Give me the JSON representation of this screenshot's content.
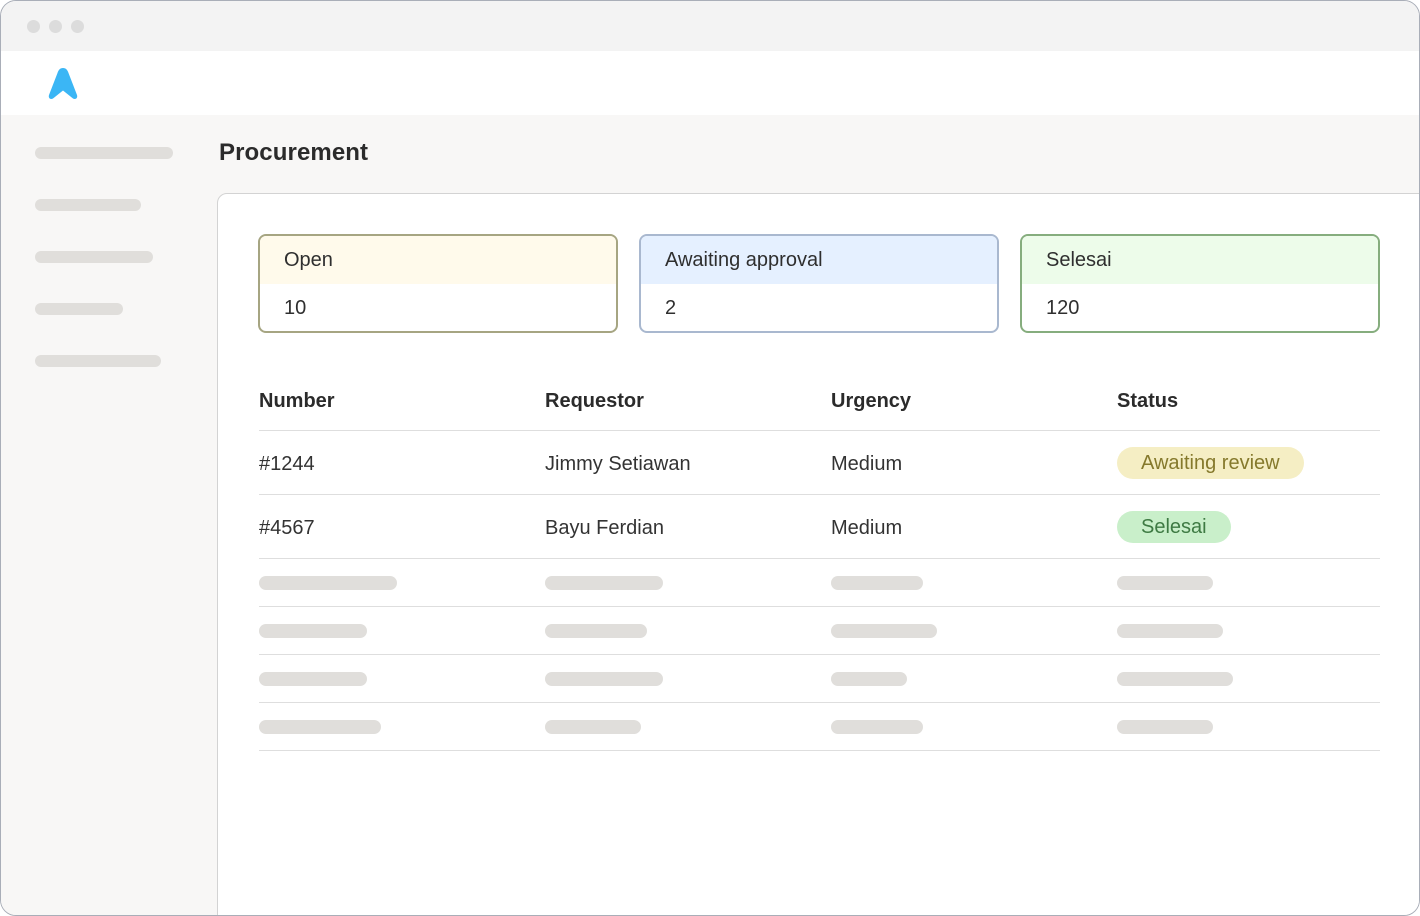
{
  "page": {
    "title": "Procurement"
  },
  "colors": {
    "accent": "#3bb6f5"
  },
  "summary": [
    {
      "label": "Open",
      "value": "10",
      "border": "#a6a582",
      "head": "#fffaeb"
    },
    {
      "label": "Awaiting approval",
      "value": "2",
      "border": "#a9b8cf",
      "head": "#e5f0ff"
    },
    {
      "label": "Selesai",
      "value": "120",
      "border": "#86ad7e",
      "head": "#edfcea"
    }
  ],
  "table": {
    "headers": [
      "Number",
      "Requestor",
      "Urgency",
      "Status"
    ],
    "rows": [
      {
        "number": "#1244",
        "requestor": "Jimmy Setiawan",
        "urgency": "Medium",
        "status": "Awaiting review",
        "status_bg": "#f5eec4",
        "status_fg": "#85792c"
      },
      {
        "number": "#4567",
        "requestor": "Bayu Ferdian",
        "urgency": "Medium",
        "status": "Selesai",
        "status_bg": "#c9efca",
        "status_fg": "#3e7a43"
      }
    ]
  }
}
